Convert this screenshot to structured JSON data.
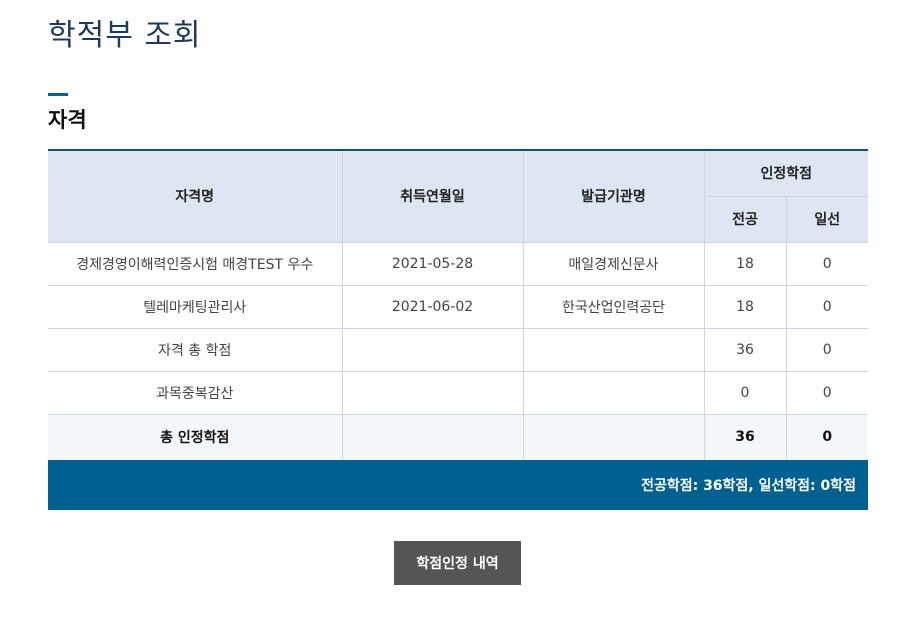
{
  "page": {
    "title": "학적부 조회"
  },
  "section": {
    "title": "자격"
  },
  "table": {
    "headers": {
      "name": "자격명",
      "date": "취득연월일",
      "issuer": "발급기관명",
      "credit_group": "인정학점",
      "major": "전공",
      "general": "일선"
    },
    "rows": [
      {
        "name": "경제경영이해력인증시험 매경TEST 우수",
        "date": "2021-05-28",
        "issuer": "매일경제신문사",
        "major": "18",
        "general": "0"
      },
      {
        "name": "텔레마케팅관리사",
        "date": "2021-06-02",
        "issuer": "한국산업인력공단",
        "major": "18",
        "general": "0"
      },
      {
        "name": "자격 총 학점",
        "date": "",
        "issuer": "",
        "major": "36",
        "general": "0"
      },
      {
        "name": "과목중복감산",
        "date": "",
        "issuer": "",
        "major": "0",
        "general": "0"
      }
    ],
    "total": {
      "name": "총 인정학점",
      "date": "",
      "issuer": "",
      "major": "36",
      "general": "0"
    }
  },
  "summary": {
    "text": "전공학점: 36학점, 일선학점: 0학점"
  },
  "actions": {
    "credit_history_label": "학점인정 내역"
  },
  "colors": {
    "title": "#1f3a5c",
    "header_bg": "#dde6f1",
    "summary_bg": "#00608f",
    "button_bg": "#555555"
  }
}
